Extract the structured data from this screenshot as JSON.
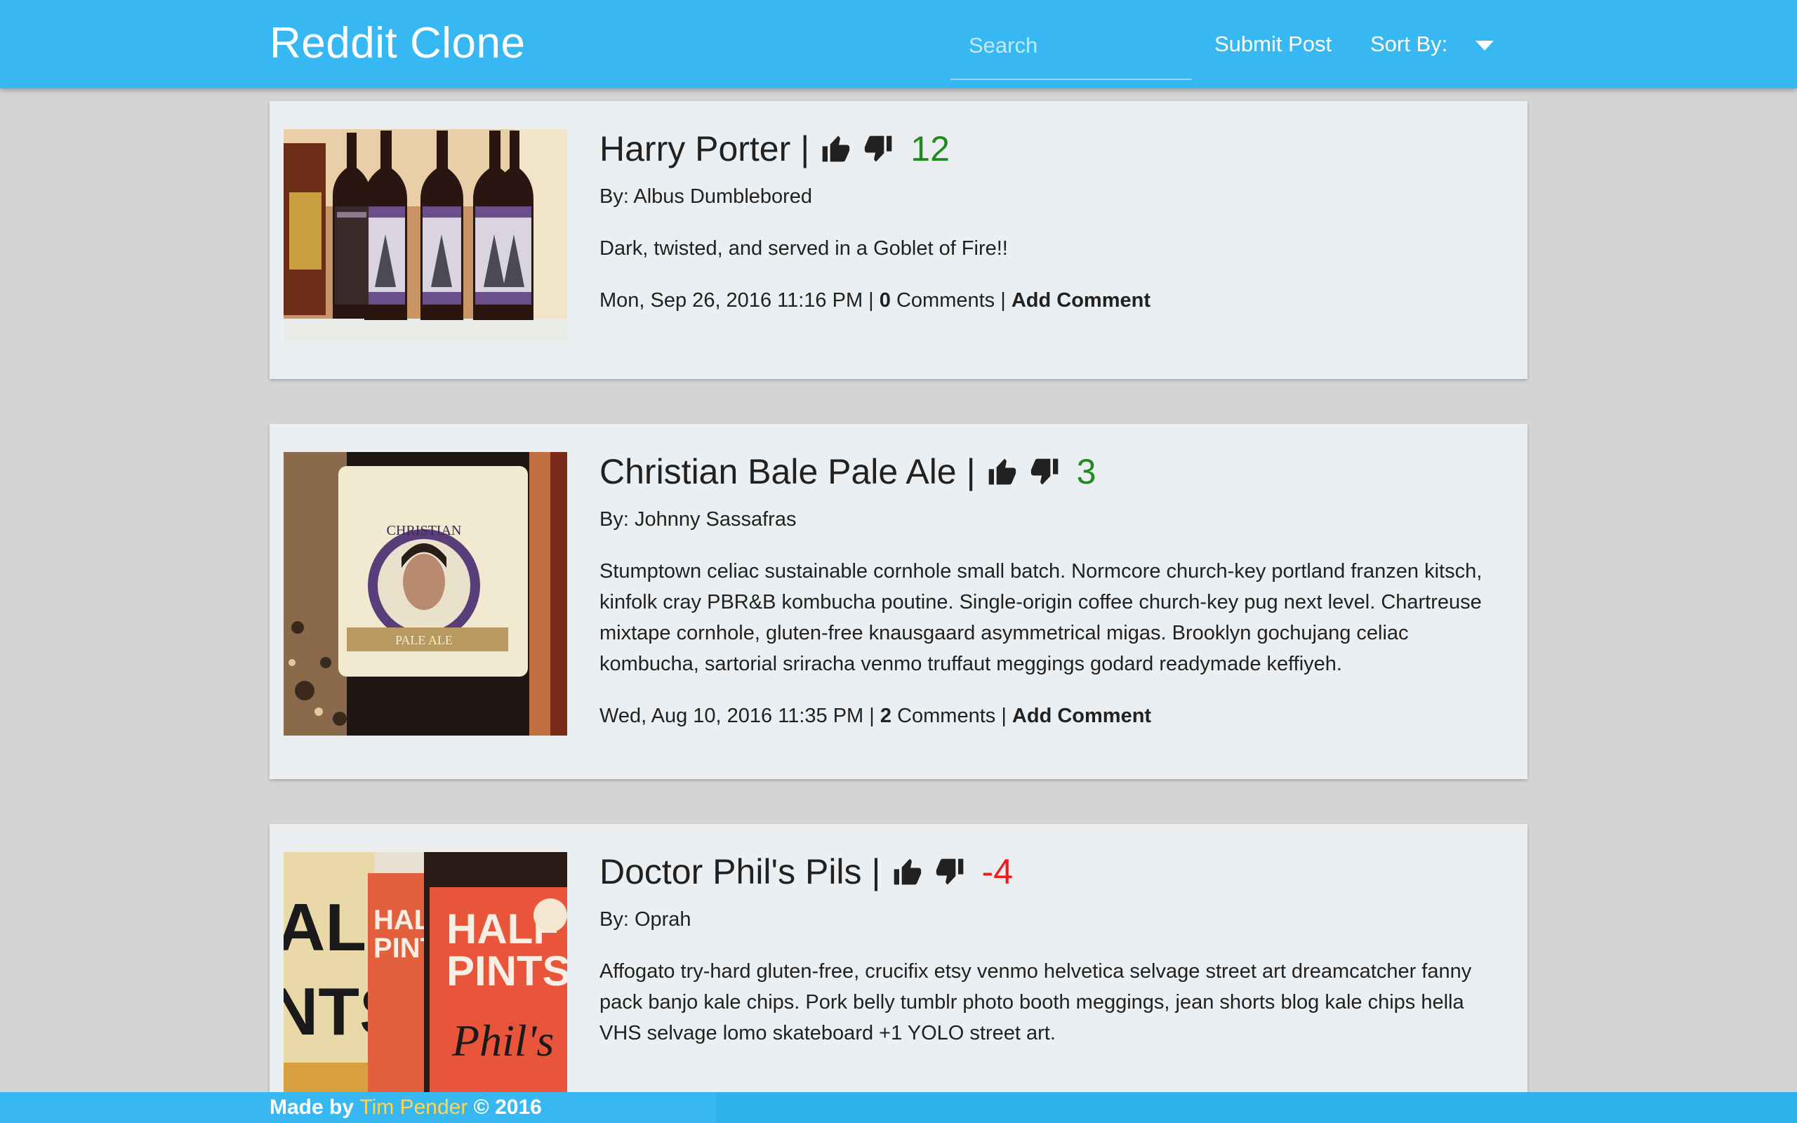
{
  "header": {
    "brand": "Reddit Clone",
    "search_placeholder": "Search",
    "submit_label": "Submit Post",
    "sort_label": "Sort By:"
  },
  "posts": [
    {
      "title": "Harry Porter",
      "separator": "|",
      "score": "12",
      "author_line": "By: Albus Dumblebored",
      "description": "Dark, twisted, and served in a Goblet of Fire!!",
      "date": "Mon, Sep 26, 2016 11:16 PM",
      "comment_count": "0",
      "comments_word": "Comments",
      "add_comment": "Add Comment",
      "image": "beer bottles with purple wizard labels reading HARRY PORTER"
    },
    {
      "title": "Christian Bale Pale Ale",
      "separator": "|",
      "score": "3",
      "author_line": "By: Johnny Sassafras",
      "description": "Stumptown celiac sustainable cornhole small batch. Normcore church-key portland franzen kitsch, kinfolk cray PBR&B kombucha poutine. Single-origin coffee church-key pug next level. Chartreuse mixtape cornhole, gluten-free knausgaard asymmetrical migas. Brooklyn gochujang celiac kombucha, sartorial sriracha venmo truffaut meggings godard readymade keffiyeh.",
      "date": "Wed, Aug 10, 2016 11:35 PM",
      "comment_count": "2",
      "comments_word": "Comments",
      "add_comment": "Add Comment",
      "image": "beer bottle with CHRISTIAN PALE ALE label on granite counter"
    },
    {
      "title": "Doctor Phil's Pils",
      "separator": "|",
      "score": "-4",
      "author_line": "By: Oprah",
      "description": "Affogato try-hard gluten-free, crucifix etsy venmo helvetica selvage street art dreamcatcher fanny pack banjo kale chips. Pork belly tumblr photo booth meggings, jean shorts blog kale chips hella VHS selvage lomo skateboard +1 YOLO street art.",
      "image": "orange HALF PINTS Phil's bottles and can"
    }
  ],
  "footer": {
    "made_by": "Made by",
    "author": "Tim Pender",
    "copyright": "© 2016"
  },
  "colors": {
    "primary": "#38b8f2",
    "background": "#d4d4d4",
    "card": "#eceff1",
    "score_positive": "#1f8a1f",
    "score_negative": "#ee1c1c",
    "footer_author": "#ffd54f"
  },
  "icons": [
    "thumbs-up-icon",
    "thumbs-down-icon",
    "caret-down-icon"
  ]
}
